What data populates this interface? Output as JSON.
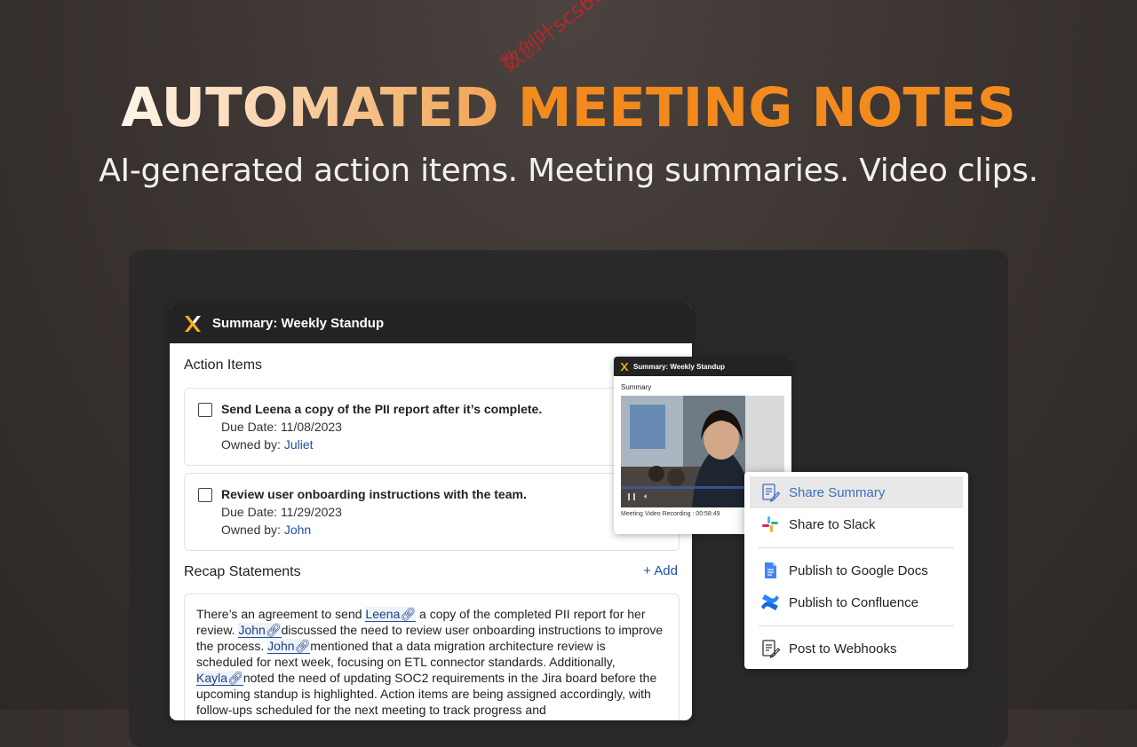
{
  "hero": {
    "title_part1": "AUTOMATED",
    "title_part2": "MEETING NOTES",
    "subtitle": "AI-generated action items. Meeting summaries. Video clips.",
    "watermark": "数创叶scs66"
  },
  "summary_card": {
    "header_title": "Summary: Weekly Standup",
    "action_items_heading": "Action Items",
    "action_items": [
      {
        "title": "Send Leena a copy of the PII report after it’s complete.",
        "due_label": "Due Date:",
        "due": "11/08/2023",
        "owner_label": "Owned by:",
        "owner": "Juliet"
      },
      {
        "title": "Review user onboarding instructions with the team.",
        "due_label": "Due Date:",
        "due": "11/29/2023",
        "owner_label": "Owned by:",
        "owner": "John"
      }
    ],
    "recap_heading": "Recap Statements",
    "add_label": "Add",
    "recap": {
      "p1": "There’s an agreement to send ",
      "m1": "Leena",
      "p2": " a copy of the completed PII report for her review. ",
      "m2": "John",
      "p3": "discussed the need to review user onboarding instructions to improve the process. ",
      "m3": "John",
      "p4": "mentioned that a data migration architecture review is scheduled for next week, focusing on ETL connector standards. Additionally, ",
      "m4": "Kayla",
      "p5": "noted the need of updating SOC2 requirements in the Jira board before the upcoming standup is highlighted. Action items are being assigned accordingly, with follow-ups scheduled for the next meeting to track progress and"
    }
  },
  "mini_card": {
    "header_title": "Summary: Weekly Standup",
    "summary_label": "Summary",
    "video_caption": "Meeting Video Recording : 00:58:49"
  },
  "share_menu": {
    "items": [
      {
        "label": "Share Summary",
        "icon": "share-summary-icon"
      },
      {
        "label": "Share to Slack",
        "icon": "slack-icon"
      },
      {
        "label": "Publish to Google Docs",
        "icon": "google-docs-icon"
      },
      {
        "label": "Publish to Confluence",
        "icon": "confluence-icon"
      },
      {
        "label": "Post to Webhooks",
        "icon": "webhook-icon"
      }
    ]
  },
  "colors": {
    "accent_orange": "#f38a1e",
    "link_blue": "#1f4e9e",
    "header_dark": "#232323"
  }
}
